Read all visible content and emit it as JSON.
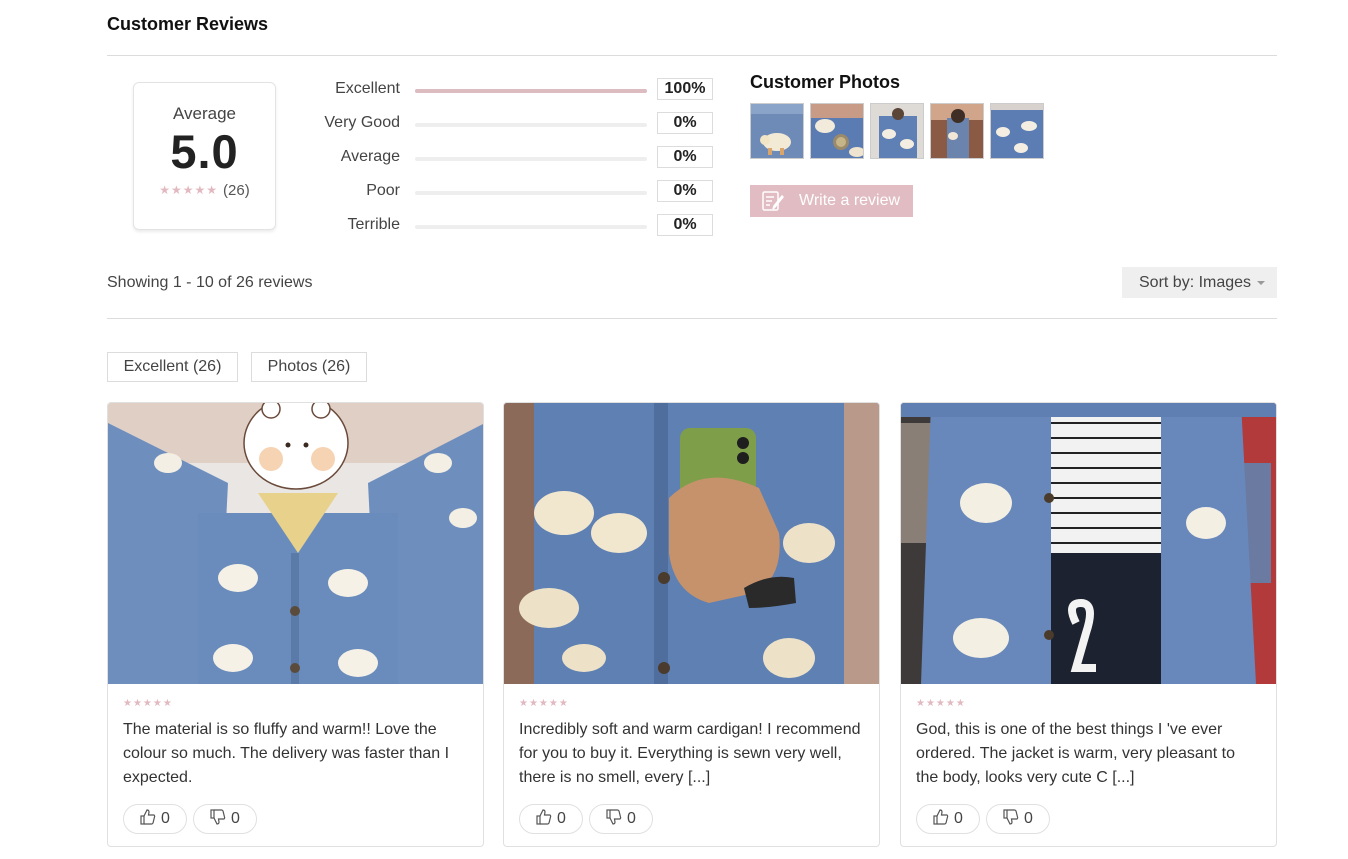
{
  "header": {
    "title": "Customer Reviews"
  },
  "summary": {
    "average_label": "Average",
    "average_value": "5.0",
    "stars": "★★★★★",
    "count": "(26)",
    "rating_fraction": 1.0
  },
  "distribution": [
    {
      "label": "Excellent",
      "percent": "100%",
      "fill": 1.0
    },
    {
      "label": "Very Good",
      "percent": "0%",
      "fill": 0
    },
    {
      "label": "Average",
      "percent": "0%",
      "fill": 0
    },
    {
      "label": "Poor",
      "percent": "0%",
      "fill": 0
    },
    {
      "label": "Terrible",
      "percent": "0%",
      "fill": 0
    }
  ],
  "customer_photos": {
    "title": "Customer Photos",
    "thumbnails": [
      "photo-1",
      "photo-2",
      "photo-3",
      "photo-4",
      "photo-5"
    ],
    "write_review_label": "Write a review",
    "write_review_icon": "pencil-note-icon"
  },
  "toolbar": {
    "showing": "Showing 1 - 10 of 26 reviews",
    "sort_label": "Sort by: Images"
  },
  "filters": [
    {
      "label": "Excellent (26)"
    },
    {
      "label": "Photos (26)"
    }
  ],
  "reviews": [
    {
      "stars": "★★★★★",
      "text": "The material is so fluffy and warm!! Love the colour so much. The delivery was faster than I expected.",
      "likes": "0",
      "dislikes": "0"
    },
    {
      "stars": "★★★★★",
      "text": "Incredibly soft and warm cardigan! I recommend for you to buy it. Everything is sewn very well, there is no smell, every [...]",
      "likes": "0",
      "dislikes": "0"
    },
    {
      "stars": "★★★★★",
      "text": "God, this is one of the best things I 've ever ordered. The jacket is warm, very pleasant to the body, looks very cute C [...]",
      "likes": "0",
      "dislikes": "0"
    }
  ],
  "colors": {
    "accent": "#e1bcc2",
    "star": "#e2b9c0",
    "cardigan_blue": "#5f7fae"
  }
}
